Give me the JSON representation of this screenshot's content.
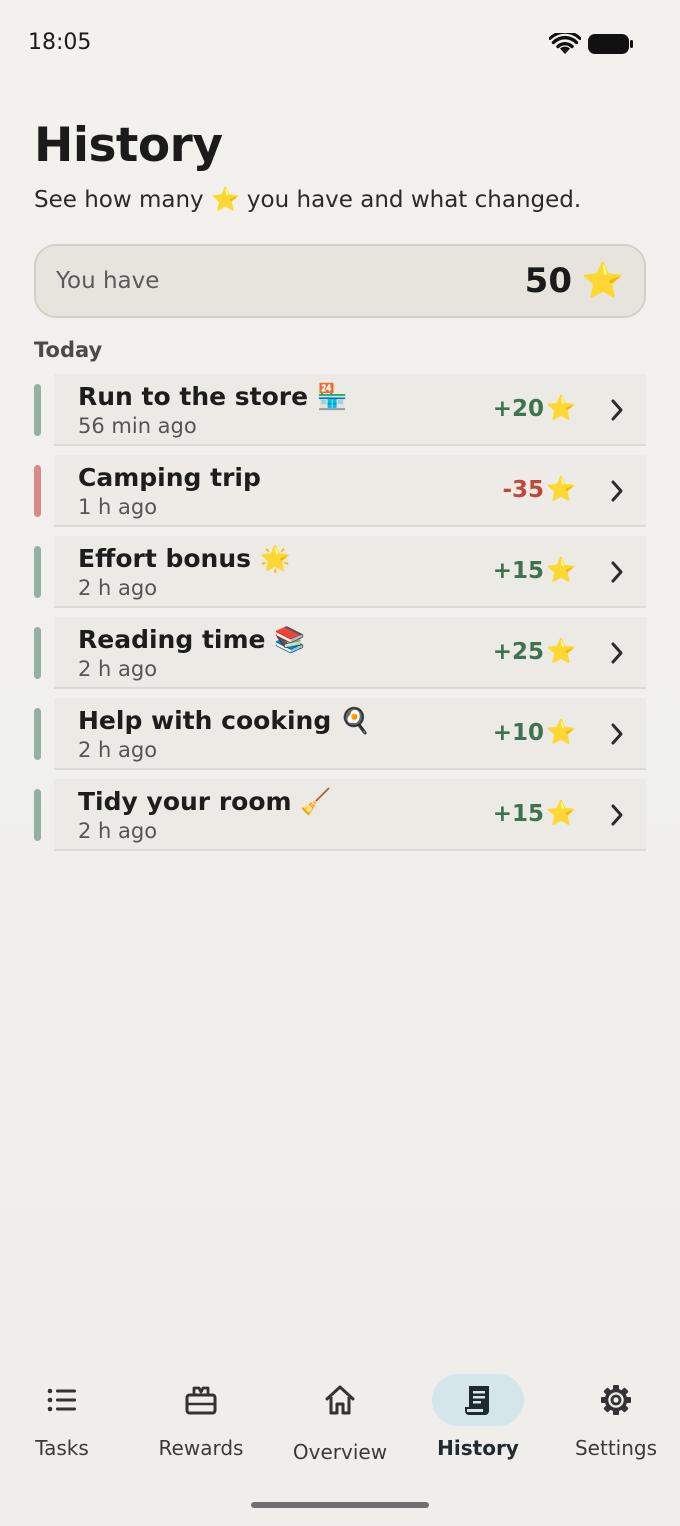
{
  "status_bar": {
    "time": "18:05"
  },
  "header": {
    "title": "History",
    "subtitle": "See how many ⭐ you have and what changed."
  },
  "balance": {
    "label": "You have",
    "value": "50",
    "star": "⭐"
  },
  "section": {
    "label": "Today"
  },
  "colors": {
    "positive": "#3f7350",
    "negative": "#c0473f",
    "positive_bar": "#93b19e",
    "negative_bar": "#d98a86",
    "nav_active": "#d4e6ea"
  },
  "rows": [
    {
      "title": "Run to the store 🏪",
      "time": "56 min ago",
      "amount": "+20",
      "star": "⭐",
      "kind": "positive"
    },
    {
      "title": "Camping trip",
      "time": "1 h ago",
      "amount": "-35",
      "star": "⭐",
      "kind": "negative"
    },
    {
      "title": "Effort bonus 🌟",
      "time": "2 h ago",
      "amount": "+15",
      "star": "⭐",
      "kind": "positive"
    },
    {
      "title": "Reading time 📚",
      "time": "2 h ago",
      "amount": "+25",
      "star": "⭐",
      "kind": "positive"
    },
    {
      "title": "Help with cooking 🍳",
      "time": "2 h ago",
      "amount": "+10",
      "star": "⭐",
      "kind": "positive"
    },
    {
      "title": "Tidy your room 🧹",
      "time": "2 h ago",
      "amount": "+15",
      "star": "⭐",
      "kind": "positive"
    }
  ],
  "nav": {
    "items": [
      {
        "label": "Tasks",
        "icon": "list-icon"
      },
      {
        "label": "Rewards",
        "icon": "gift-icon"
      },
      {
        "label": "Overview",
        "icon": "home-icon"
      },
      {
        "label": "History",
        "icon": "receipt-icon",
        "active": true
      },
      {
        "label": "Settings",
        "icon": "gear-icon"
      }
    ]
  }
}
